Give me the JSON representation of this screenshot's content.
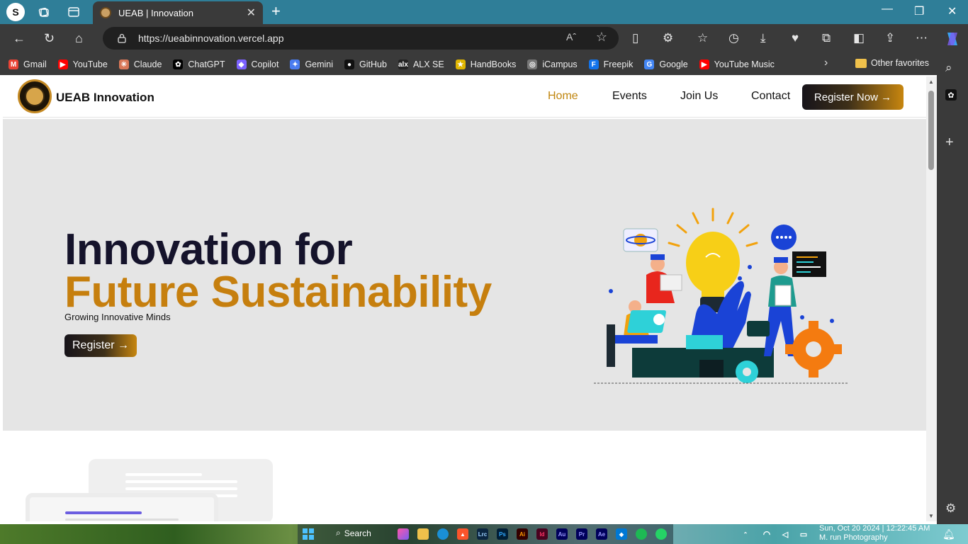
{
  "browser": {
    "profile_initial": "S",
    "tab_title": "UEAB | Innovation",
    "url": "https://ueabinnovation.vercel.app",
    "read_aloud_label": "Aˆ",
    "bookmarks": [
      {
        "label": "Gmail",
        "color": "#ea4335",
        "glyph": "M"
      },
      {
        "label": "YouTube",
        "color": "#ff0000",
        "glyph": "▶"
      },
      {
        "label": "Claude",
        "color": "#d97757",
        "glyph": "✳"
      },
      {
        "label": "ChatGPT",
        "color": "#000000",
        "glyph": "✿"
      },
      {
        "label": "Copilot",
        "color": "#7b61ff",
        "glyph": "◆"
      },
      {
        "label": "Gemini",
        "color": "#4a7cf0",
        "glyph": "✦"
      },
      {
        "label": "GitHub",
        "color": "#111111",
        "glyph": "●"
      },
      {
        "label": "ALX SE",
        "color": "#222222",
        "glyph": "alx"
      },
      {
        "label": "HandBooks",
        "color": "#e0b600",
        "glyph": "★"
      },
      {
        "label": "iCampus",
        "color": "#777777",
        "glyph": "◎"
      },
      {
        "label": "Freepik",
        "color": "#1273eb",
        "glyph": "F"
      },
      {
        "label": "Google",
        "color": "#4285f4",
        "glyph": "G"
      },
      {
        "label": "YouTube Music",
        "color": "#ff0000",
        "glyph": "▶"
      }
    ],
    "other_favorites": "Other favorites"
  },
  "site": {
    "brand": "UEAB Innovation",
    "nav": [
      "Home",
      "Events",
      "Join Us",
      "Contact"
    ],
    "active_nav": "Home",
    "register_now": "Register Now →",
    "accent_color": "#c67f0e"
  },
  "hero": {
    "title_line1": "Innovation for",
    "title_line2": "Future Sustainability",
    "subtitle": "Growing Innovative Minds",
    "button": "Register →"
  },
  "taskbar": {
    "search": "Search",
    "clock_line1": "Sun, Oct 20 2024 | 12:22:45 AM",
    "clock_line2": "M. run Photography"
  }
}
